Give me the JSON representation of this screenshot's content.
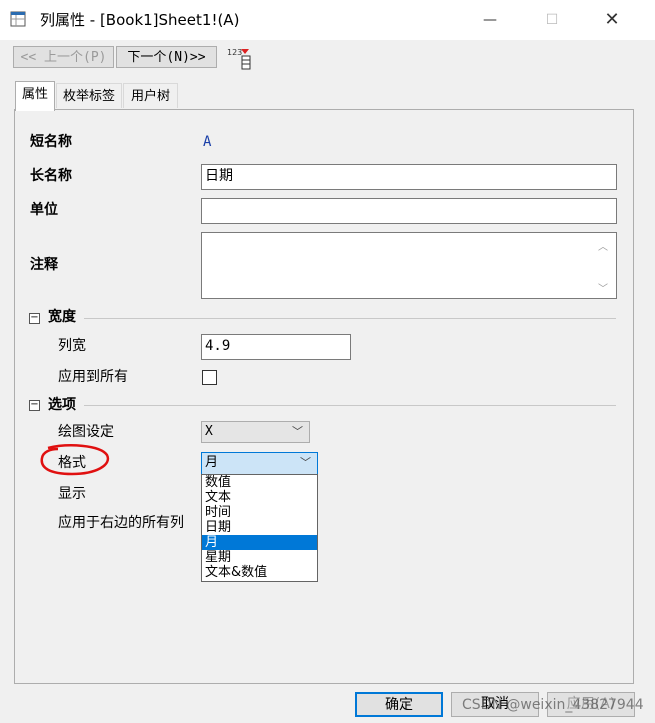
{
  "window": {
    "title": "列属性 - [Book1]Sheet1!(A)",
    "minimize": "—",
    "maximize": "☐",
    "close": "✕"
  },
  "nav": {
    "prev": "<< 上一个(P)",
    "next": "下一个(N)>>"
  },
  "tabs": [
    "属性",
    "枚举标签",
    "用户树"
  ],
  "fields": {
    "short_name_label": "短名称",
    "short_name_value": "A",
    "long_name_label": "长名称",
    "long_name_value": "日期",
    "unit_label": "单位",
    "unit_value": "",
    "comment_label": "注释",
    "comment_value": ""
  },
  "width_section": {
    "toggle": "−",
    "title": "宽度",
    "col_width_label": "列宽",
    "col_width_value": "4.9",
    "apply_all_label": "应用到所有"
  },
  "options_section": {
    "toggle": "−",
    "title": "选项",
    "plot_label": "绘图设定",
    "plot_value": "X",
    "format_label": "格式",
    "format_value": "月",
    "display_label": "显示",
    "apply_right_label": "应用于右边的所有列",
    "format_options": [
      "数值",
      "文本",
      "时间",
      "日期",
      "月",
      "星期",
      "文本&数值"
    ],
    "selected_index": 4
  },
  "buttons": {
    "ok": "确定",
    "cancel": "取消",
    "apply": "应用(A)"
  },
  "watermark": "CSDN @weixin_43827944",
  "colors": {
    "selection": "#0078d7",
    "annotation": "#e01010"
  }
}
